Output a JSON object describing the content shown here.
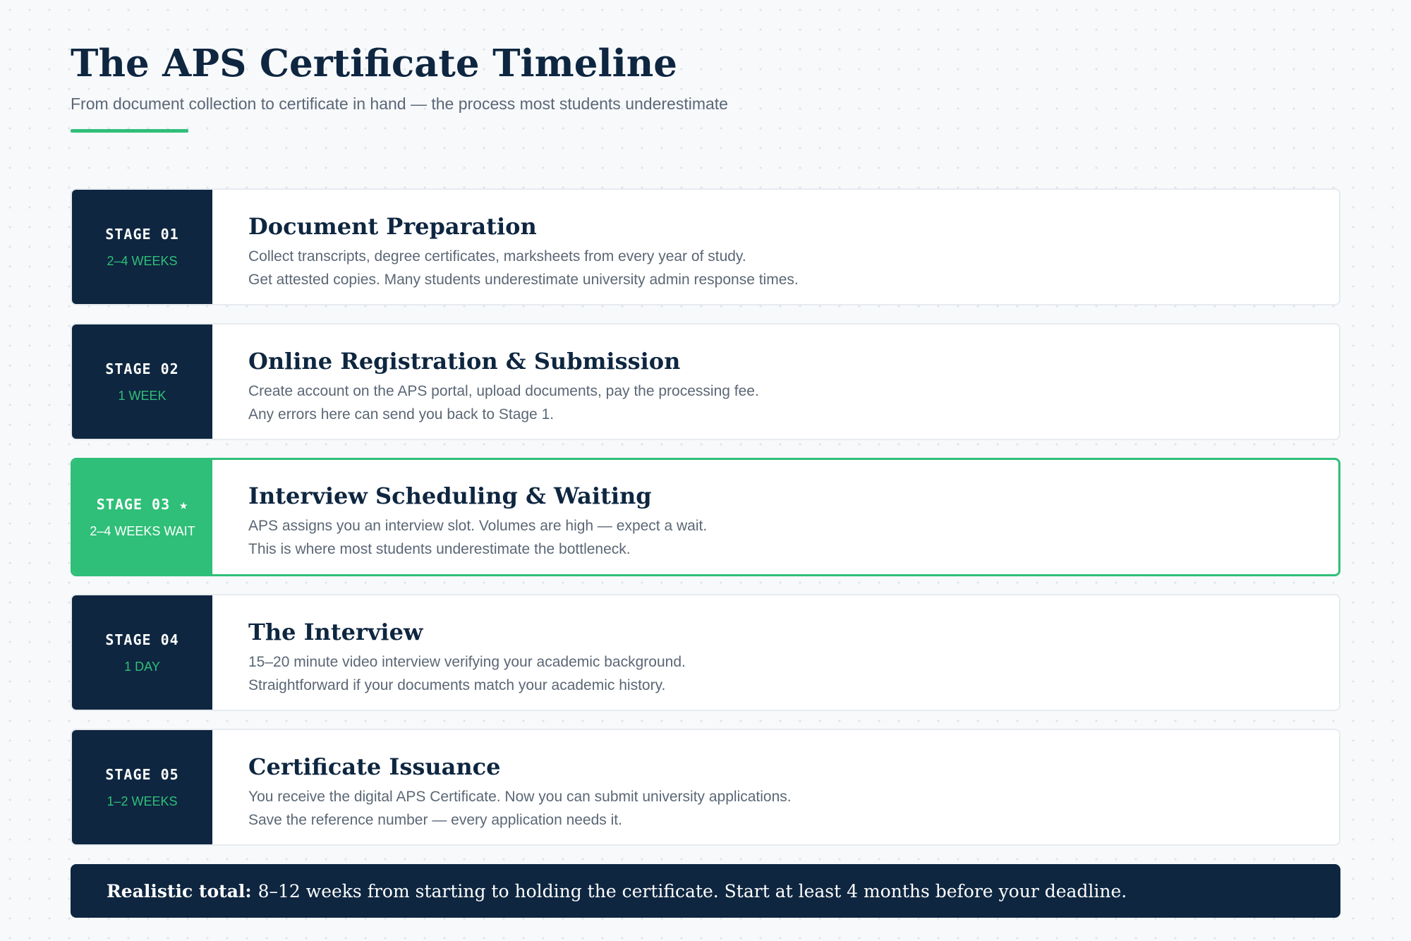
{
  "header": {
    "title": "The APS Certificate Timeline",
    "subtitle": "From document collection to certificate in hand — the process most students underestimate"
  },
  "stages": [
    {
      "label": "STAGE 01",
      "duration": "2–4 WEEKS",
      "title": "Document Preparation",
      "lines": [
        "Collect transcripts, degree certificates, marksheets from every year of study.",
        "Get attested copies. Many students underestimate university admin response times."
      ],
      "highlighted": false
    },
    {
      "label": "STAGE 02",
      "duration": "1 WEEK",
      "title": "Online Registration & Submission",
      "lines": [
        "Create account on the APS portal, upload documents, pay the processing fee.",
        "Any errors here can send you back to Stage 1."
      ],
      "highlighted": false
    },
    {
      "label": "STAGE 03 ★",
      "duration": "2–4 WEEKS WAIT",
      "title": "Interview Scheduling & Waiting",
      "lines": [
        "APS assigns you an interview slot. Volumes are high — expect a wait.",
        "This is where most students underestimate the bottleneck."
      ],
      "highlighted": true
    },
    {
      "label": "STAGE 04",
      "duration": "1 DAY",
      "title": "The Interview",
      "lines": [
        "15–20 minute video interview verifying your academic background.",
        "Straightforward if your documents match your academic history."
      ],
      "highlighted": false
    },
    {
      "label": "STAGE 05",
      "duration": "1–2 WEEKS",
      "title": "Certificate Issuance",
      "lines": [
        "You receive the digital APS Certificate. Now you can submit university applications.",
        "Save the reference number — every application needs it."
      ],
      "highlighted": false
    }
  ],
  "summary": {
    "label": "Realistic total:",
    "text": "8–12 weeks from starting to holding the certificate. Start at least 4 months before your deadline."
  },
  "colors": {
    "navy": "#0e2640",
    "accent_green": "#2fbf78",
    "muted_text": "#5b6775",
    "background": "#f7f9fb"
  }
}
